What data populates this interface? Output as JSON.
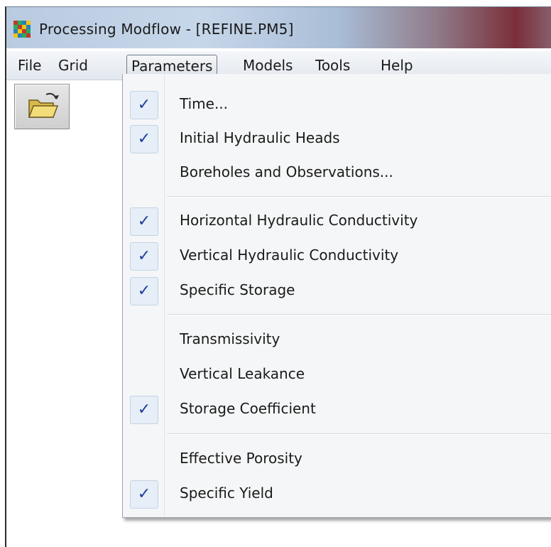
{
  "window": {
    "title": "Processing Modflow - [REFINE.PM5]",
    "app_icon": "app-grid-icon"
  },
  "menubar": {
    "items": [
      {
        "label": "File"
      },
      {
        "label": "Grid"
      },
      {
        "label": "Parameters",
        "active": true
      },
      {
        "label": "Models"
      },
      {
        "label": "Tools"
      },
      {
        "label": "Help"
      }
    ]
  },
  "toolbar": {
    "open_icon": "open-folder-icon"
  },
  "parameters_menu": {
    "groups": [
      [
        {
          "label": "Time...",
          "checked": true
        },
        {
          "label": "Initial Hydraulic Heads",
          "checked": true
        },
        {
          "label": "Boreholes and Observations...",
          "checked": false
        }
      ],
      [
        {
          "label": "Horizontal Hydraulic Conductivity",
          "checked": true
        },
        {
          "label": "Vertical Hydraulic Conductivity",
          "checked": true
        },
        {
          "label": "Specific Storage",
          "checked": true
        }
      ],
      [
        {
          "label": "Transmissivity",
          "checked": false
        },
        {
          "label": "Vertical Leakance",
          "checked": false
        },
        {
          "label": "Storage Coefficient",
          "checked": true
        }
      ],
      [
        {
          "label": "Effective Porosity",
          "checked": false
        },
        {
          "label": "Specific Yield",
          "checked": true
        }
      ]
    ]
  },
  "colors": {
    "check": "#1f3f9a",
    "menu_bg": "#f5f6f7"
  }
}
